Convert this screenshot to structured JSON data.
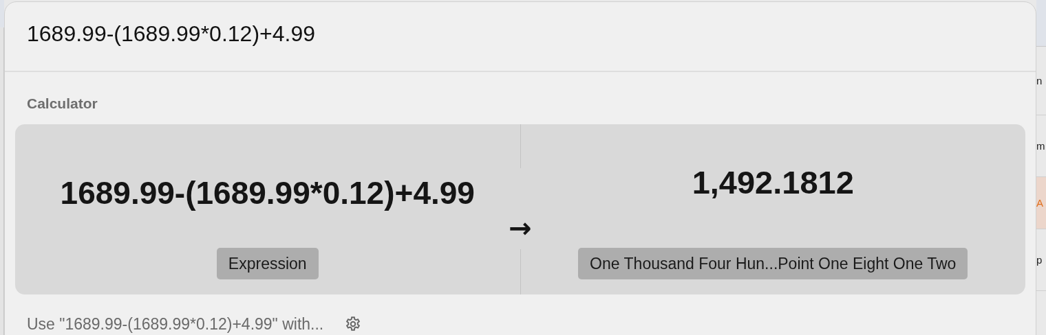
{
  "search": {
    "value": "1689.99-(1689.99*0.12)+4.99"
  },
  "section_title": "Calculator",
  "calculator": {
    "expression": "1689.99-(1689.99*0.12)+4.99",
    "arrow": "→",
    "result": "1,492.1812",
    "expression_label": "Expression",
    "result_label": "One Thousand Four Hun...Point One Eight One Two"
  },
  "footer": {
    "text": "Use \"1689.99-(1689.99*0.12)+4.99\" with..."
  },
  "background_rows": [
    {
      "text": "n",
      "kind": "plain"
    },
    {
      "text": "m",
      "kind": "plain"
    },
    {
      "text": "A",
      "kind": "highlight"
    },
    {
      "text": "p",
      "kind": "plain"
    }
  ]
}
